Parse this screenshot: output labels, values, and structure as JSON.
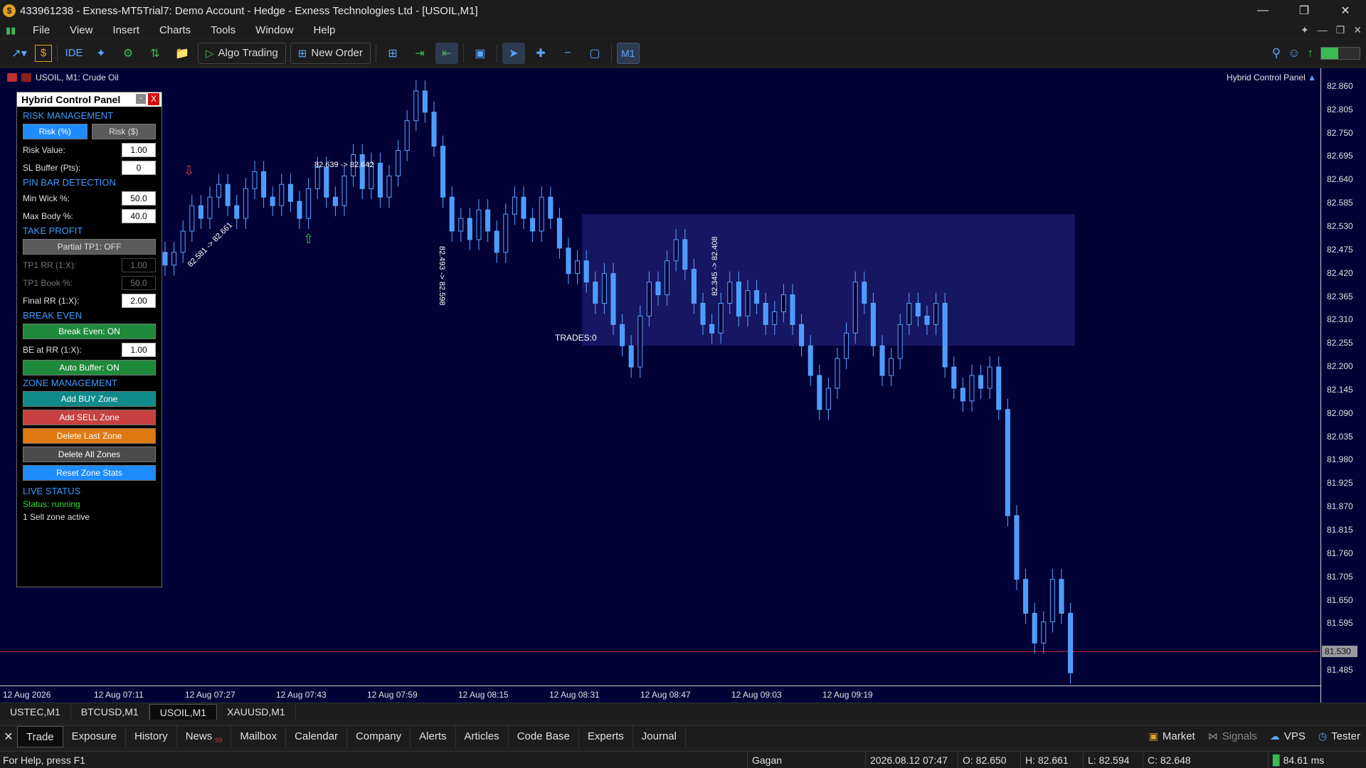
{
  "window": {
    "title": "433961238 - Exness-MT5Trial7: Demo Account - Hedge - Exness Technologies Ltd - [USOIL,M1]",
    "controls": [
      "minimize",
      "restore",
      "close"
    ]
  },
  "menu": {
    "items": [
      "File",
      "View",
      "Insert",
      "Charts",
      "Tools",
      "Window",
      "Help"
    ]
  },
  "toolbar": {
    "ide_label": "IDE",
    "algo_trading_label": "Algo Trading",
    "new_order_label": "New Order",
    "period_label": "M1",
    "level_fraction": 0.45
  },
  "chart": {
    "symbol_label": "USOIL, M1:  Crude Oil",
    "indicator_tag": "Hybrid Control Panel",
    "trades_label": "TRADES:0",
    "current_price": "81.530",
    "price_labels": [
      "82.860",
      "82.805",
      "82.750",
      "82.695",
      "82.640",
      "82.585",
      "82.530",
      "82.475",
      "82.420",
      "82.365",
      "82.310",
      "82.255",
      "82.200",
      "82.145",
      "82.090",
      "82.035",
      "81.980",
      "81.925",
      "81.870",
      "81.815",
      "81.760",
      "81.705",
      "81.650",
      "81.595",
      "81.530",
      "81.485"
    ],
    "time_labels": [
      "12 Aug 2026",
      "12 Aug 07:11",
      "12 Aug 07:27",
      "12 Aug 07:43",
      "12 Aug 07:59",
      "12 Aug 08:15",
      "12 Aug 08:31",
      "12 Aug 08:47",
      "12 Aug 09:03",
      "12 Aug 09:19"
    ],
    "annotations": {
      "trade1": "82.581 -> 82.661",
      "trade2": "82.639 -> 82.642",
      "trade3": "82.493 -> 82.598",
      "trade4": "82.345 -> 82.408"
    }
  },
  "chart_data": {
    "type": "candlestick",
    "symbol": "USOIL",
    "timeframe": "M1",
    "ylim": [
      81.46,
      82.88
    ],
    "closes": [
      82.44,
      82.47,
      82.52,
      82.58,
      82.55,
      82.6,
      82.63,
      82.58,
      82.55,
      82.62,
      82.66,
      82.6,
      82.58,
      82.63,
      82.59,
      82.55,
      82.62,
      82.67,
      82.6,
      82.58,
      82.65,
      82.7,
      82.62,
      82.68,
      82.6,
      82.65,
      82.71,
      82.78,
      82.85,
      82.8,
      82.72,
      82.6,
      82.52,
      82.55,
      82.5,
      82.57,
      82.52,
      82.47,
      82.56,
      82.6,
      82.55,
      82.52,
      82.6,
      82.55,
      82.48,
      82.42,
      82.45,
      82.4,
      82.35,
      82.42,
      82.3,
      82.25,
      82.2,
      82.32,
      82.4,
      82.37,
      82.45,
      82.5,
      82.43,
      82.35,
      82.3,
      82.28,
      82.35,
      82.4,
      82.32,
      82.38,
      82.35,
      82.3,
      82.33,
      82.37,
      82.3,
      82.25,
      82.18,
      82.1,
      82.15,
      82.22,
      82.28,
      82.4,
      82.35,
      82.25,
      82.18,
      82.22,
      82.3,
      82.35,
      82.32,
      82.3,
      82.35,
      82.2,
      82.15,
      82.12,
      82.18,
      82.15,
      82.2,
      82.1,
      81.85,
      81.7,
      81.62,
      81.55,
      81.6,
      81.7,
      81.62,
      81.48
    ],
    "range_box": {
      "from_index": 47,
      "to_index": 101,
      "top": 82.56,
      "bottom": 82.25
    },
    "horizontal_lines": [
      81.53
    ]
  },
  "panel": {
    "title": "Hybrid Control Panel",
    "min_label": "-",
    "close_label": "X",
    "risk_management": "RISK MANAGEMENT",
    "risk_pct": "Risk (%)",
    "risk_usd": "Risk ($)",
    "risk_value_label": "Risk Value:",
    "risk_value": "1.00",
    "sl_buffer_label": "SL Buffer (Pts):",
    "sl_buffer": "0",
    "pin_bar": "PIN BAR DETECTION",
    "min_wick_label": "Min Wick %:",
    "min_wick": "50.0",
    "max_body_label": "Max Body %:",
    "max_body": "40.0",
    "take_profit": "TAKE PROFIT",
    "partial_tp": "Partial TP1: OFF",
    "tp1_rr_label": "TP1 RR (1:X):",
    "tp1_rr": "1.00",
    "tp1_book_label": "TP1 Book %:",
    "tp1_book": "50.0",
    "final_rr_label": "Final RR (1:X):",
    "final_rr": "2.00",
    "break_even": "BREAK EVEN",
    "break_even_btn": "Break Even: ON",
    "be_rr_label": "BE at RR (1:X):",
    "be_rr": "1.00",
    "auto_buffer": "Auto Buffer: ON",
    "zone_mgmt": "ZONE MANAGEMENT",
    "add_buy": "Add BUY Zone",
    "add_sell": "Add SELL Zone",
    "delete_last": "Delete Last Zone",
    "delete_all": "Delete All Zones",
    "reset_stats": "Reset Zone Stats",
    "live_status": "LIVE STATUS",
    "status_text": "Status: running",
    "zone_text": "1 Sell zone active"
  },
  "symbol_tabs": [
    "USTEC,M1",
    "BTCUSD,M1",
    "USOIL,M1",
    "XAUUSD,M1"
  ],
  "toolbox": {
    "tabs": [
      "Trade",
      "Exposure",
      "History",
      "News",
      "Mailbox",
      "Calendar",
      "Company",
      "Alerts",
      "Articles",
      "Code Base",
      "Experts",
      "Journal"
    ],
    "news_badge": "99",
    "right": [
      "Market",
      "Signals",
      "VPS",
      "Tester"
    ]
  },
  "statusbar": {
    "help": "For Help, press F1",
    "profile": "Gagan",
    "datetime": "2026.08.12 07:47",
    "open": "O: 82.650",
    "high": "H: 82.661",
    "low": "L: 82.594",
    "close": "C: 82.648",
    "ping": "84.61 ms"
  }
}
